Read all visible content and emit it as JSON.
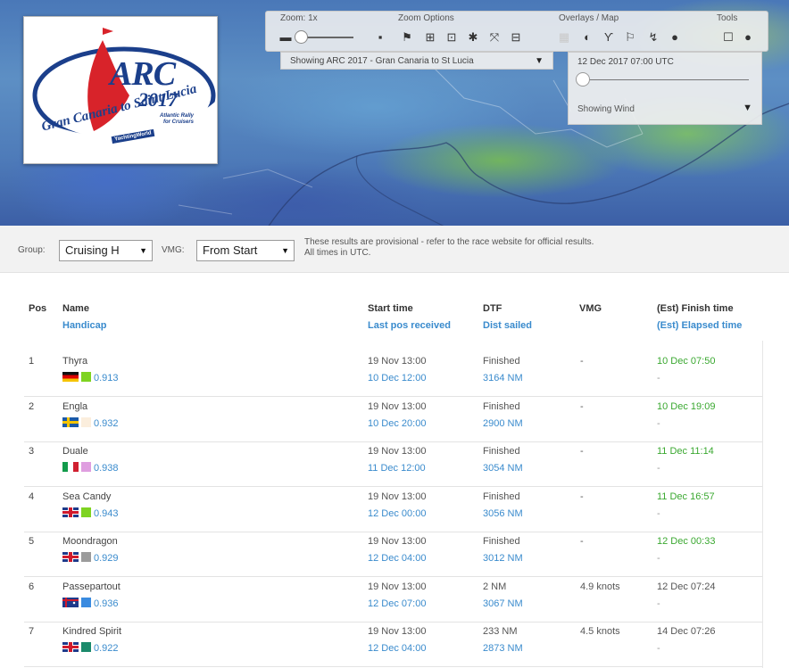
{
  "map": {
    "toolbar": {
      "zoom_label": "Zoom: 1x",
      "zoom_options_label": "Zoom Options",
      "overlays_label": "Overlays / Map",
      "tools_label": "Tools"
    },
    "race_select": "Showing ARC 2017 - Gran Canaria to St Lucia",
    "overlay": {
      "date_time": "12 Dec 2017 07:00 UTC",
      "layer": "Showing Wind"
    }
  },
  "logo": {
    "title": "ARC",
    "year": "2017",
    "subtitle": "Atlantic Rally for Cruisers",
    "route": "Gran Canaria to Saint Lucia",
    "sponsor": "YachtingWorld"
  },
  "filters": {
    "group_label": "Group:",
    "group_value": "Cruising H",
    "vmg_label": "VMG:",
    "vmg_value": "From Start",
    "notice_line1": "These results are provisional - refer to the race website for official results.",
    "notice_line2": "All times in UTC."
  },
  "table": {
    "headers": {
      "pos": "Pos",
      "name": "Name",
      "handicap": "Handicap",
      "start": "Start time",
      "last_pos": "Last pos received",
      "dtf": "DTF",
      "sailed": "Dist sailed",
      "vmg": "VMG",
      "finish": "(Est) Finish time",
      "elapsed": "(Est) Elapsed time"
    },
    "rows": [
      {
        "pos": "1",
        "name": "Thyra",
        "flag": "de",
        "swatch": "#7ed321",
        "handicap": "0.913",
        "start": "19 Nov 13:00",
        "last": "10 Dec 12:00",
        "dtf": "Finished",
        "sailed": "3164 NM",
        "vmg": "-",
        "finish": "10 Dec 07:50",
        "finish_color": "#3aa830",
        "elapsed": "-"
      },
      {
        "pos": "2",
        "name": "Engla",
        "flag": "se",
        "swatch": "#fbeedd",
        "handicap": "0.932",
        "start": "19 Nov 13:00",
        "last": "10 Dec 20:00",
        "dtf": "Finished",
        "sailed": "2900 NM",
        "vmg": "-",
        "finish": "10 Dec 19:09",
        "finish_color": "#3aa830",
        "elapsed": "-"
      },
      {
        "pos": "3",
        "name": "Duale",
        "flag": "it",
        "swatch": "#df9ee0",
        "handicap": "0.938",
        "start": "19 Nov 13:00",
        "last": "11 Dec 12:00",
        "dtf": "Finished",
        "sailed": "3054 NM",
        "vmg": "-",
        "finish": "11 Dec 11:14",
        "finish_color": "#3aa830",
        "elapsed": "-"
      },
      {
        "pos": "4",
        "name": "Sea Candy",
        "flag": "gb",
        "swatch": "#7ed321",
        "handicap": "0.943",
        "start": "19 Nov 13:00",
        "last": "12 Dec 00:00",
        "dtf": "Finished",
        "sailed": "3056 NM",
        "vmg": "-",
        "finish": "11 Dec 16:57",
        "finish_color": "#3aa830",
        "elapsed": "-"
      },
      {
        "pos": "5",
        "name": "Moondragon",
        "flag": "gb",
        "swatch": "#9b9b9b",
        "handicap": "0.929",
        "start": "19 Nov 13:00",
        "last": "12 Dec 04:00",
        "dtf": "Finished",
        "sailed": "3012 NM",
        "vmg": "-",
        "finish": "12 Dec 00:33",
        "finish_color": "#3aa830",
        "elapsed": "-"
      },
      {
        "pos": "6",
        "name": "Passepartout",
        "flag": "au",
        "swatch": "#3a8be0",
        "handicap": "0.936",
        "start": "19 Nov 13:00",
        "last": "12 Dec 07:00",
        "dtf": "2 NM",
        "sailed": "3067 NM",
        "vmg": "4.9 knots",
        "finish": "12 Dec 07:24",
        "finish_color": "#555555",
        "elapsed": "-"
      },
      {
        "pos": "7",
        "name": "Kindred Spirit",
        "flag": "gb",
        "swatch": "#1b8a6b",
        "handicap": "0.922",
        "start": "19 Nov 13:00",
        "last": "12 Dec 04:00",
        "dtf": "233 NM",
        "sailed": "2873 NM",
        "vmg": "4.5 knots",
        "finish": "14 Dec 07:26",
        "finish_color": "#555555",
        "elapsed": "-"
      }
    ]
  }
}
